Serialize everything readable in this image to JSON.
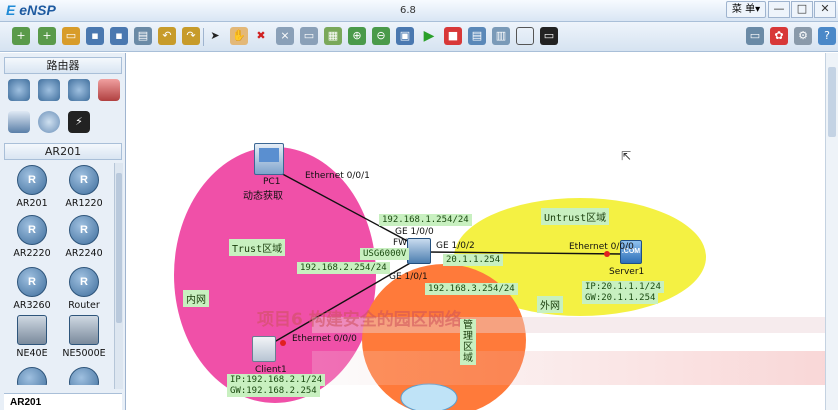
{
  "app": {
    "name": "eNSP",
    "version": "6.8",
    "menu_label": "菜 单▾"
  },
  "window_controls": [
    "—",
    "□",
    "✕"
  ],
  "toolbar": {
    "icons": [
      "new-topo-icon",
      "new-example-icon",
      "open-icon",
      "save-icon",
      "save-as-icon",
      "print-icon",
      "undo-icon",
      "redo-icon",
      "select-icon",
      "hand-icon",
      "delete-icon",
      "delete-link-icon",
      "text-icon",
      "palette-icon",
      "zoom-in-icon",
      "zoom-out-icon",
      "fit-icon",
      "start-icon",
      "stop-icon",
      "capture-icon",
      "show-interface-icon",
      "grid-icon",
      "cli-icon"
    ],
    "right_icons": [
      "chat-icon",
      "huawei-icon",
      "settings-icon",
      "help-icon"
    ]
  },
  "sidebar": {
    "category_header": "路由器",
    "sub_header": "AR201",
    "devices": [
      {
        "label": "AR201",
        "glyph": "R"
      },
      {
        "label": "AR1220",
        "glyph": "R"
      },
      {
        "label": "AR2220",
        "glyph": "R"
      },
      {
        "label": "AR2240",
        "glyph": "R"
      },
      {
        "label": "AR3260",
        "glyph": "R"
      },
      {
        "label": "Router",
        "glyph": "R"
      },
      {
        "label": "NE40E",
        "glyph": ""
      },
      {
        "label": "NE5000E",
        "glyph": ""
      }
    ],
    "footer": "AR201"
  },
  "topology": {
    "pc1": {
      "name": "PC1",
      "sub": "动态获取",
      "iface": "Ethernet 0/0/1"
    },
    "fw": {
      "name": "FW",
      "model": "USG6000V",
      "if_top": "GE 1/0/0",
      "if_right": "GE 1/0/2",
      "if_bottom": "GE 1/0/1"
    },
    "client": {
      "name": "Client1",
      "iface": "Ethernet 0/0/0",
      "ip": "IP:192.168.2.1/24",
      "gw": "GW:192.168.2.254"
    },
    "server": {
      "name": "Server1",
      "iface": "Ethernet 0/0/0",
      "ip": "IP:20.1.1.1/24",
      "gw": "GW:20.1.1.254",
      "badge": ".COM"
    },
    "ip_tags": {
      "ge0": "192.168.1.254/24",
      "ge1": "192.168.2.254/24",
      "ge2": "20.1.1.254",
      "mgmt": "192.168.3.254/24"
    },
    "zones": {
      "trust": "Trust区域",
      "untrust": "Untrust区域",
      "inner": "内网",
      "outer": "外网",
      "mgmt": "管\n理\n区\n域"
    },
    "watermark": "项目6   构建安全的园区网络"
  },
  "colors": {
    "trust": "#f050a8",
    "untrust": "#f2ee22",
    "mgmt": "#ff7a3a",
    "tag": "#c8f0c0"
  }
}
